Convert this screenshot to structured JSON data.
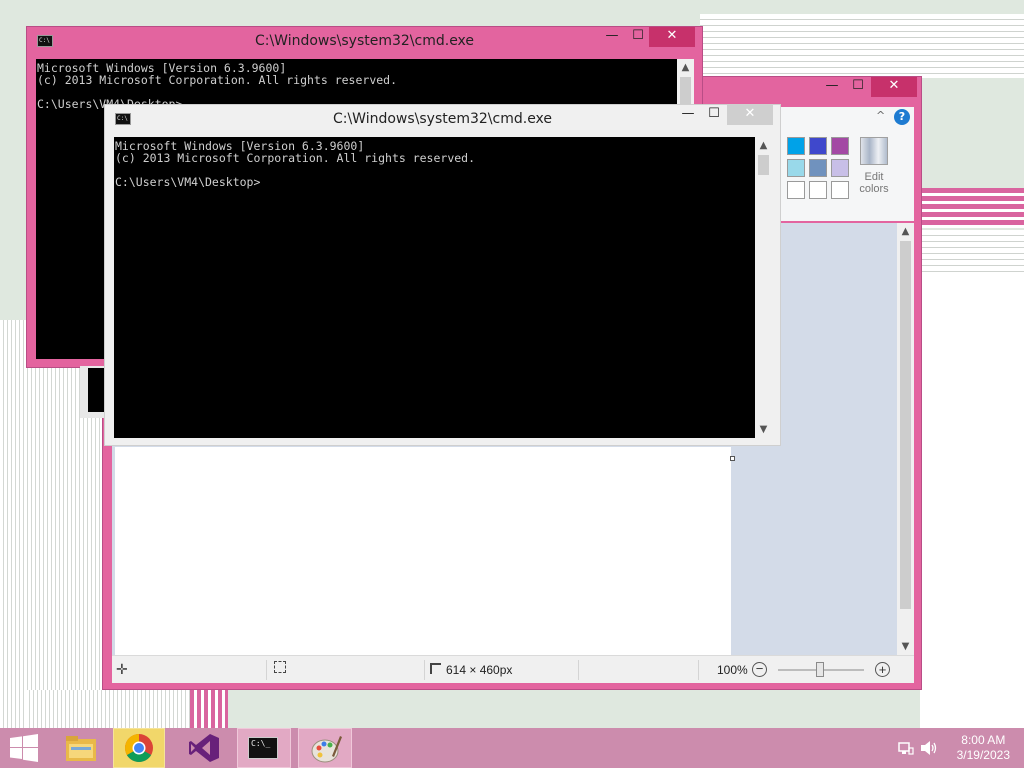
{
  "cmd_back": {
    "title": "C:\\Windows\\system32\\cmd.exe",
    "icon_text": "C:\\",
    "lines": [
      "Microsoft Windows [Version 6.3.9600]",
      "(c) 2013 Microsoft Corporation. All rights reserved.",
      "",
      "C:\\Users\\VM4\\Desktop>"
    ],
    "minimize": "—",
    "maximize": "☐",
    "close": "✕"
  },
  "cmd_front": {
    "title": "C:\\Windows\\system32\\cmd.exe",
    "icon_text": "C:\\",
    "lines": [
      "Microsoft Windows [Version 6.3.9600]",
      "(c) 2013 Microsoft Corporation. All rights reserved.",
      "",
      "C:\\Users\\VM4\\Desktop>"
    ],
    "minimize": "—",
    "maximize": "☐",
    "close": "✕"
  },
  "paint": {
    "minimize": "—",
    "maximize": "☐",
    "close": "✕",
    "help": "?",
    "collapse": "^",
    "edit_colors_line1": "Edit",
    "edit_colors_line2": "colors",
    "palette_colors": [
      "#00a2e8",
      "#3f48cc",
      "#a349a4",
      "#99d9ea",
      "#7092be",
      "#c8bfe7",
      "#ffffff",
      "#ffffff",
      "#ffffff"
    ],
    "status": {
      "dimensions": "614 × 460px",
      "zoom": "100%"
    }
  },
  "taskbar": {
    "time": "8:00 AM",
    "date": "3/19/2023",
    "cmd_icon_text": "C:\\_"
  },
  "colors": {
    "window_frame": "#e3649f",
    "close_active": "#c7316b",
    "taskbar": "#cc8cad"
  }
}
